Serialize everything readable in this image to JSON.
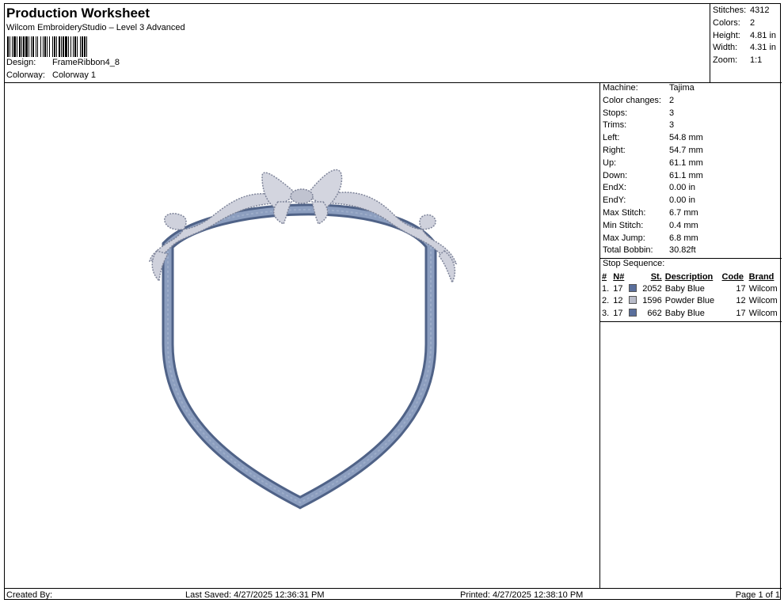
{
  "header": {
    "title": "Production Worksheet",
    "subtitle": "Wilcom EmbroideryStudio – Level 3 Advanced",
    "design_label": "Design:",
    "design_value": "FrameRibbon4_8",
    "colorway_label": "Colorway:",
    "colorway_value": "Colorway 1"
  },
  "summary": {
    "stitches_label": "Stitches:",
    "stitches_value": "4312",
    "colors_label": "Colors:",
    "colors_value": "2",
    "height_label": "Height:",
    "height_value": "4.81 in",
    "width_label": "Width:",
    "width_value": "4.31 in",
    "zoom_label": "Zoom:",
    "zoom_value": "1:1"
  },
  "details": {
    "machine_label": "Machine:",
    "machine_value": "Tajima",
    "color_changes_label": "Color changes:",
    "color_changes_value": "2",
    "stops_label": "Stops:",
    "stops_value": "3",
    "trims_label": "Trims:",
    "trims_value": "3",
    "left_label": "Left:",
    "left_value": "54.8 mm",
    "right_label": "Right:",
    "right_value": "54.7 mm",
    "up_label": "Up:",
    "up_value": "61.1 mm",
    "down_label": "Down:",
    "down_value": "61.1 mm",
    "endx_label": "EndX:",
    "endx_value": "0.00 in",
    "endy_label": "EndY:",
    "endy_value": "0.00 in",
    "max_stitch_label": "Max Stitch:",
    "max_stitch_value": "6.7 mm",
    "min_stitch_label": "Min Stitch:",
    "min_stitch_value": "0.4 mm",
    "max_jump_label": "Max Jump:",
    "max_jump_value": "6.8 mm",
    "total_bobbin_label": "Total Bobbin:",
    "total_bobbin_value": "30.82ft"
  },
  "stop_sequence": {
    "title": "Stop Sequence:",
    "headers": {
      "num": "#",
      "n": "N#",
      "st": "St.",
      "description": "Description",
      "code": "Code",
      "brand": "Brand"
    },
    "rows": [
      {
        "num": "1.",
        "n": "17",
        "color": "#5a6f9c",
        "st": "2052",
        "description": "Baby Blue",
        "code": "17",
        "brand": "Wilcom"
      },
      {
        "num": "2.",
        "n": "12",
        "color": "#b9bcc9",
        "st": "1596",
        "description": "Powder Blue",
        "code": "12",
        "brand": "Wilcom"
      },
      {
        "num": "3.",
        "n": "17",
        "color": "#5a6f9c",
        "st": "662",
        "description": "Baby Blue",
        "code": "17",
        "brand": "Wilcom"
      }
    ]
  },
  "footer": {
    "created_by": "Created By:",
    "last_saved": "Last Saved: 4/27/2025 12:36:31 PM",
    "printed": "Printed: 4/27/2025 12:38:10 PM",
    "page": "Page 1 of 1"
  },
  "colors": {
    "frame": "#6f83a6",
    "frame_dark": "#4f6287",
    "ribbon": "#c9cbd6",
    "ribbon_edge": "#8a8fa3"
  }
}
